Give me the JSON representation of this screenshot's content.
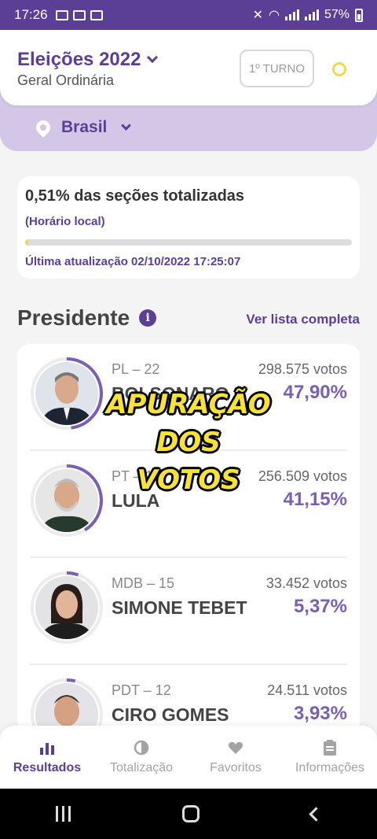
{
  "status_bar": {
    "time": "17:26",
    "battery": "57%"
  },
  "header": {
    "title": "Eleições 2022",
    "subtitle": "Geral Ordinária",
    "turno_label": "1º TURNO"
  },
  "location": {
    "label": "Brasil"
  },
  "progress": {
    "title": "0,51% das seções totalizadas",
    "local_time_note": "(Horário local)",
    "fraction": 0.0051,
    "last_update": "Última atualização 02/10/2022 17:25:07"
  },
  "section": {
    "title": "Presidente",
    "view_all": "Ver lista completa"
  },
  "candidates": [
    {
      "party": "PL – 22",
      "name": "BOLSONARO",
      "votes": "298.575 votos",
      "pct": "47,90%",
      "share": 0.479
    },
    {
      "party": "PT – 13",
      "name": "LULA",
      "votes": "256.509 votos",
      "pct": "41,15%",
      "share": 0.4115
    },
    {
      "party": "MDB – 15",
      "name": "SIMONE TEBET",
      "votes": "33.452 votos",
      "pct": "5,37%",
      "share": 0.0537
    },
    {
      "party": "PDT – 12",
      "name": "CIRO GOMES",
      "votes": "24.511 votos",
      "pct": "3,93%",
      "share": 0.0393
    }
  ],
  "caption": {
    "line1": "APURAÇÃO DOS",
    "line2": "VOTOS"
  },
  "bottom_nav": [
    {
      "label": "Resultados",
      "icon": "bar-chart-icon",
      "active": true
    },
    {
      "label": "Totalização",
      "icon": "pie-chart-icon",
      "active": false
    },
    {
      "label": "Favoritos",
      "icon": "heart-icon",
      "active": false
    },
    {
      "label": "Informações",
      "icon": "clipboard-icon",
      "active": false
    }
  ],
  "colors": {
    "primary": "#5b3f97",
    "accent": "#f2d84a",
    "band": "#d4c6e7",
    "percent": "#7a5fb4"
  }
}
